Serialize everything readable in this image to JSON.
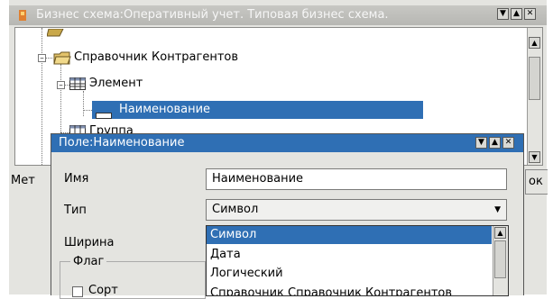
{
  "outer_window": {
    "title": "Бизнес схема:Оперативный учет. Типовая бизнес схема.",
    "side_left_label": "Мет",
    "side_right_label": "ок"
  },
  "tree": {
    "items": [
      {
        "label": "Справочник Контрагентов",
        "icon": "folder-icon"
      },
      {
        "label": "Элемент",
        "icon": "table-icon"
      },
      {
        "label": "Наименование",
        "icon": "field-icon",
        "selected": true
      },
      {
        "label": "Группа",
        "icon": "table-icon"
      }
    ]
  },
  "dialog": {
    "title": "Поле:Наименование",
    "name_label": "Имя",
    "name_value": "Наименование",
    "type_label": "Тип",
    "type_value": "Символ",
    "width_label": "Ширина",
    "group_title": "Флаг",
    "checkbox_label": "Сорт"
  },
  "dropdown": {
    "options": [
      "Символ",
      "Дата",
      "Логический",
      "Справочник Справочник Контрагентов"
    ],
    "selected": "Символ"
  },
  "colors": {
    "selection": "#2f6fb4",
    "window_bg": "#e4e4e0"
  }
}
